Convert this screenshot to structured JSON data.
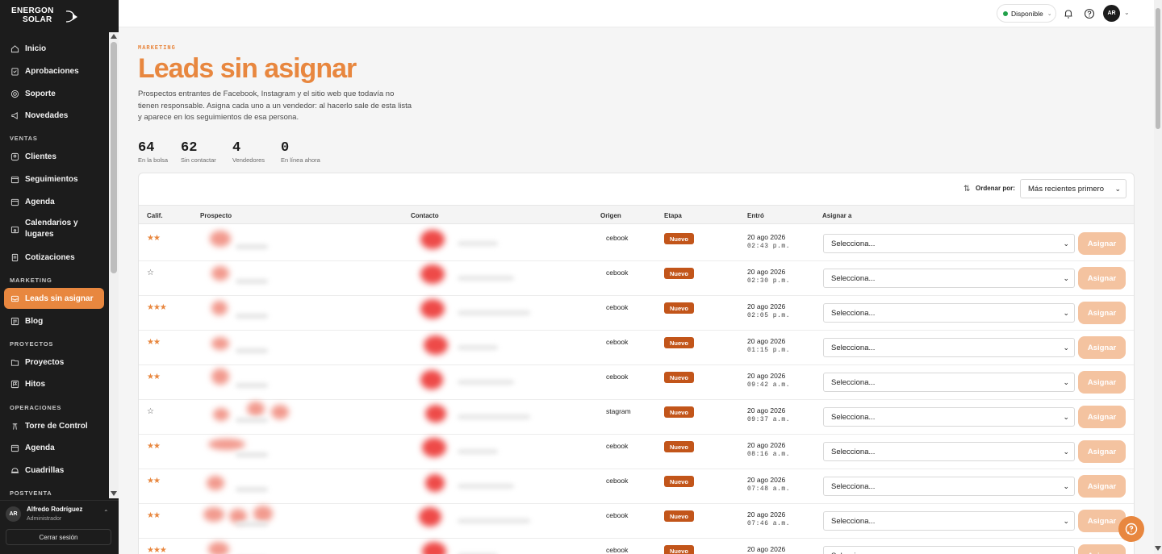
{
  "brand": {
    "line1": "ENERGON",
    "line2": "SOLAR"
  },
  "sidebar": {
    "items_top": [
      {
        "label": "Inicio",
        "icon": "home-icon"
      },
      {
        "label": "Aprobaciones",
        "icon": "clipboard-icon"
      },
      {
        "label": "Soporte",
        "icon": "lifebuoy-icon"
      },
      {
        "label": "Novedades",
        "icon": "megaphone-icon"
      }
    ],
    "sections": {
      "ventas": "VENTAS",
      "marketing": "MARKETING",
      "proyectos": "PROYECTOS",
      "operaciones": "OPERACIONES",
      "postventa": "POSTVENTA"
    },
    "ventas": [
      {
        "label": "Clientes",
        "icon": "users-icon"
      },
      {
        "label": "Seguimientos",
        "icon": "calendar-check-icon"
      },
      {
        "label": "Agenda",
        "icon": "calendar-icon"
      },
      {
        "label": "Calendarios y lugares",
        "icon": "calendar-pin-icon"
      },
      {
        "label": "Cotizaciones",
        "icon": "document-icon"
      }
    ],
    "marketing": [
      {
        "label": "Leads sin asignar",
        "icon": "inbox-icon"
      },
      {
        "label": "Blog",
        "icon": "blog-icon"
      }
    ],
    "proyectos": [
      {
        "label": "Proyectos",
        "icon": "folder-icon"
      },
      {
        "label": "Hitos",
        "icon": "flag-icon"
      }
    ],
    "operaciones": [
      {
        "label": "Torre de Control",
        "icon": "tower-icon"
      },
      {
        "label": "Agenda",
        "icon": "calendar-icon"
      },
      {
        "label": "Cuadrillas",
        "icon": "helmet-icon"
      }
    ],
    "user": {
      "initials": "AR",
      "name": "Alfredo Rodríguez",
      "role": "Administrador",
      "logout": "Cerrar sesión"
    }
  },
  "topbar": {
    "status": "Disponible",
    "avatar": "AR"
  },
  "page": {
    "eyebrow": "MARKETING",
    "title": "Leads sin asignar",
    "description": "Prospectos entrantes de Facebook, Instagram y el sitio web que todavía no tienen responsable. Asigna cada uno a un vendedor: al hacerlo sale de esta lista y aparece en los seguimientos de esa persona."
  },
  "stats": [
    {
      "value": "64",
      "label": "En la bolsa"
    },
    {
      "value": "62",
      "label": "Sin contactar"
    },
    {
      "value": "4",
      "label": "Vendedores"
    },
    {
      "value": "0",
      "label": "En línea ahora"
    }
  ],
  "table": {
    "sort_label": "Ordenar por:",
    "sort_value": "Más recientes primero",
    "headers": {
      "calif": "Calif.",
      "prospecto": "Prospecto",
      "contacto": "Contacto",
      "origen": "Origen",
      "etapa": "Etapa",
      "entro": "Entró",
      "asignar": "Asignar a"
    },
    "select_placeholder": "Selecciona...",
    "assign_button": "Asignar",
    "rows": [
      {
        "rating": 2,
        "origin": "cebook",
        "stage": "Nuevo",
        "date": "20 ago 2026",
        "time": "02:43 p.m."
      },
      {
        "rating": 0,
        "origin": "cebook",
        "stage": "Nuevo",
        "date": "20 ago 2026",
        "time": "02:30 p.m."
      },
      {
        "rating": 3,
        "origin": "cebook",
        "stage": "Nuevo",
        "date": "20 ago 2026",
        "time": "02:05 p.m."
      },
      {
        "rating": 2,
        "origin": "cebook",
        "stage": "Nuevo",
        "date": "20 ago 2026",
        "time": "01:15 p.m."
      },
      {
        "rating": 2,
        "origin": "cebook",
        "stage": "Nuevo",
        "date": "20 ago 2026",
        "time": "09:42 a.m."
      },
      {
        "rating": 0,
        "origin": "stagram",
        "stage": "Nuevo",
        "date": "20 ago 2026",
        "time": "09:37 a.m."
      },
      {
        "rating": 2,
        "origin": "cebook",
        "stage": "Nuevo",
        "date": "20 ago 2026",
        "time": "08:16 a.m."
      },
      {
        "rating": 2,
        "origin": "cebook",
        "stage": "Nuevo",
        "date": "20 ago 2026",
        "time": "07:48 a.m."
      },
      {
        "rating": 2,
        "origin": "cebook",
        "stage": "Nuevo",
        "date": "20 ago 2026",
        "time": "07:46 a.m."
      },
      {
        "rating": 3,
        "origin": "cebook",
        "stage": "Nuevo",
        "date": "20 ago 2026",
        "time": ""
      }
    ]
  },
  "colors": {
    "accent": "#e8873f",
    "stage": "#c2551a",
    "sidebar": "#1c1c1c",
    "button_disabled": "#f4c3a0"
  }
}
